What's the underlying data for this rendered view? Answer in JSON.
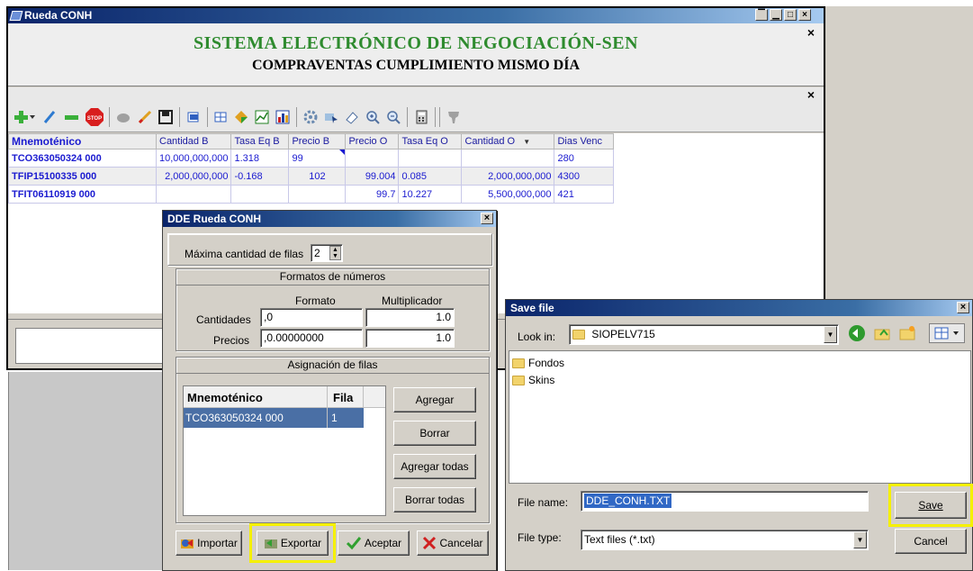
{
  "main_window": {
    "title": "Rueda CONH",
    "sen_title": "SISTEMA ELECTRÓNICO DE NEGOCIACIÓN-SEN",
    "sen_subtitle": "COMPRAVENTAS CUMPLIMIENTO MISMO DÍA",
    "close_glyph": "×",
    "window_buttons": [
      "▔",
      "▁",
      "□",
      "×"
    ]
  },
  "toolbar": {
    "icons": [
      "add-icon",
      "dropdown-icon",
      "edit-icon",
      "remove-icon",
      "stop-icon",
      "hands-icon",
      "pencil-icon",
      "save-disk-icon",
      "copy-icon",
      "grid-icon",
      "diamond-icon",
      "chart-line-icon",
      "chart-bar-icon",
      "gear-icon",
      "cursor-icon",
      "eraser-icon",
      "zoom-in-icon",
      "zoom-out-icon",
      "calculator-icon",
      "country-map-icon"
    ],
    "stop_label": "STOP"
  },
  "grid": {
    "columns": [
      "Mnemoténico",
      "Cantidad B",
      "Tasa Eq B",
      "Precio B",
      "Precio O",
      "Tasa Eq O",
      "Cantidad O",
      "Dias Venc"
    ],
    "sort_glyph": "▼",
    "rows": [
      [
        "TCO363050324 000",
        "10,000,000,000",
        "1.318",
        "99",
        "",
        "",
        "",
        "280"
      ],
      [
        "TFIP15100335 000",
        "2,000,000,000",
        "-0.168",
        "102",
        "99.004",
        "0.085",
        "2,000,000,000",
        "4300"
      ],
      [
        "TFIT06110919 000",
        "",
        "",
        "",
        "99.7",
        "10.227",
        "5,500,000,000",
        "421"
      ]
    ]
  },
  "dde_dialog": {
    "title": "DDE Rueda CONH",
    "max_rows_label": "Máxima cantidad de filas",
    "max_rows_value": "2",
    "formats_header": "Formatos de números",
    "formato_header": "Formato",
    "multiplicador_header": "Multiplicador",
    "cantidades_label": "Cantidades",
    "cantidades_format": ",0",
    "cantidades_mult": "1.0",
    "precios_label": "Precios",
    "precios_format": ",0.00000000",
    "precios_mult": "1.0",
    "assignment_header": "Asignación de filas",
    "table_headers": [
      "Mnemoténico",
      "Fila"
    ],
    "table_rows": [
      [
        "TCO363050324 000",
        "1"
      ]
    ],
    "btn_agregar": "Agregar",
    "btn_borrar": "Borrar",
    "btn_agregar_todas": "Agregar todas",
    "btn_borrar_todas": "Borrar todas",
    "btn_importar": "Importar",
    "btn_exportar": "Exportar",
    "btn_aceptar": "Aceptar",
    "btn_cancelar": "Cancelar"
  },
  "save_dialog": {
    "title": "Save file",
    "look_in_label": "Look in:",
    "look_in_value": "SIOPELV715",
    "folders": [
      "Fondos",
      "Skins"
    ],
    "file_name_label": "File name:",
    "file_name_value": "DDE_CONH.TXT",
    "file_type_label": "File type:",
    "file_type_value": "Text files (*.txt)",
    "btn_save": "Save",
    "btn_cancel": "Cancel"
  },
  "colors": {
    "title_bar": "#0a246a",
    "sen_title": "#2e8b2e",
    "grid_text": "#1a1ad0",
    "highlight": "#f5f000",
    "selection": "#4a6fa5"
  }
}
